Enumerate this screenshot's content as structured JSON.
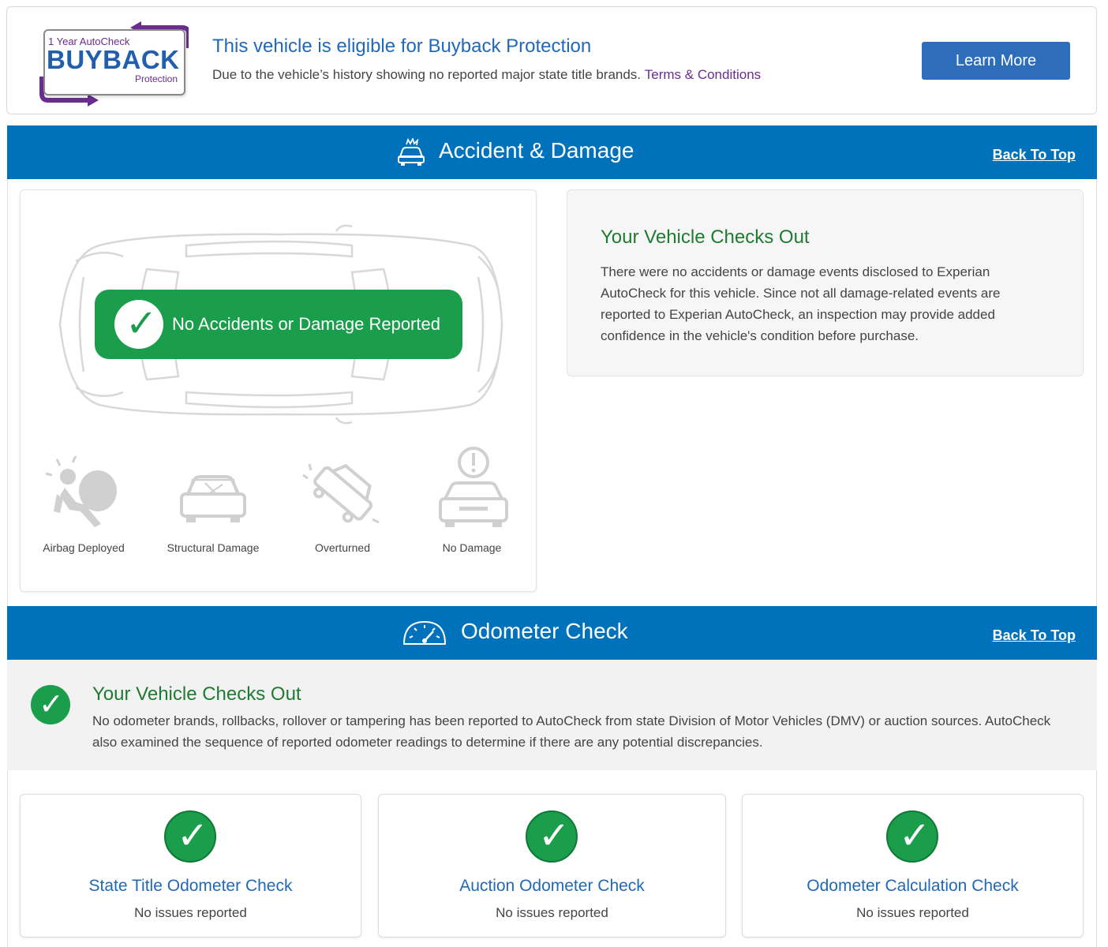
{
  "buyback": {
    "logo_year": "1 Year AutoCheck",
    "logo_main": "BUYBACK",
    "logo_sub": "Protection",
    "title": "This vehicle is eligible for Buyback Protection",
    "description": "Due to the vehicle’s history showing no reported major state title brands.",
    "terms_link": "Terms & Conditions",
    "learn_more": "Learn More"
  },
  "accident": {
    "header_title": "Accident & Damage",
    "back_to_top": "Back To Top",
    "pill_text": "No Accidents or Damage Reported",
    "icons": [
      {
        "label": "Airbag Deployed",
        "icon": "airbag-icon"
      },
      {
        "label": "Structural Damage",
        "icon": "structural-damage-icon"
      },
      {
        "label": "Overturned",
        "icon": "overturned-icon"
      },
      {
        "label": "No Damage",
        "icon": "no-damage-icon"
      }
    ],
    "checks_title": "Your Vehicle Checks Out",
    "checks_text": "There were no accidents or damage events disclosed to Experian AutoCheck for this vehicle. Since not all damage-related events are reported to Experian AutoCheck, an inspection may provide added confidence in the vehicle's condition before purchase."
  },
  "odometer": {
    "header_title": "Odometer Check",
    "back_to_top": "Back To Top",
    "checks_title": "Your Vehicle Checks Out",
    "checks_text": "No odometer brands, rollbacks, rollover or tampering has been reported to AutoCheck from state Division of Motor Vehicles (DMV) or auction sources. AutoCheck also examined the sequence of reported odometer readings to determine if there are any potential discrepancies.",
    "cards": [
      {
        "title": "State Title Odometer Check",
        "status": "No issues reported"
      },
      {
        "title": "Auction Odometer Check",
        "status": "No issues reported"
      },
      {
        "title": "Odometer Calculation Check",
        "status": "No issues reported"
      }
    ]
  },
  "colors": {
    "header_blue": "#0072bc",
    "title_blue": "#1f69b8",
    "success_green": "#1a9e4b",
    "check_title_green": "#1f7a32",
    "brand_purple": "#6b2c8f"
  }
}
